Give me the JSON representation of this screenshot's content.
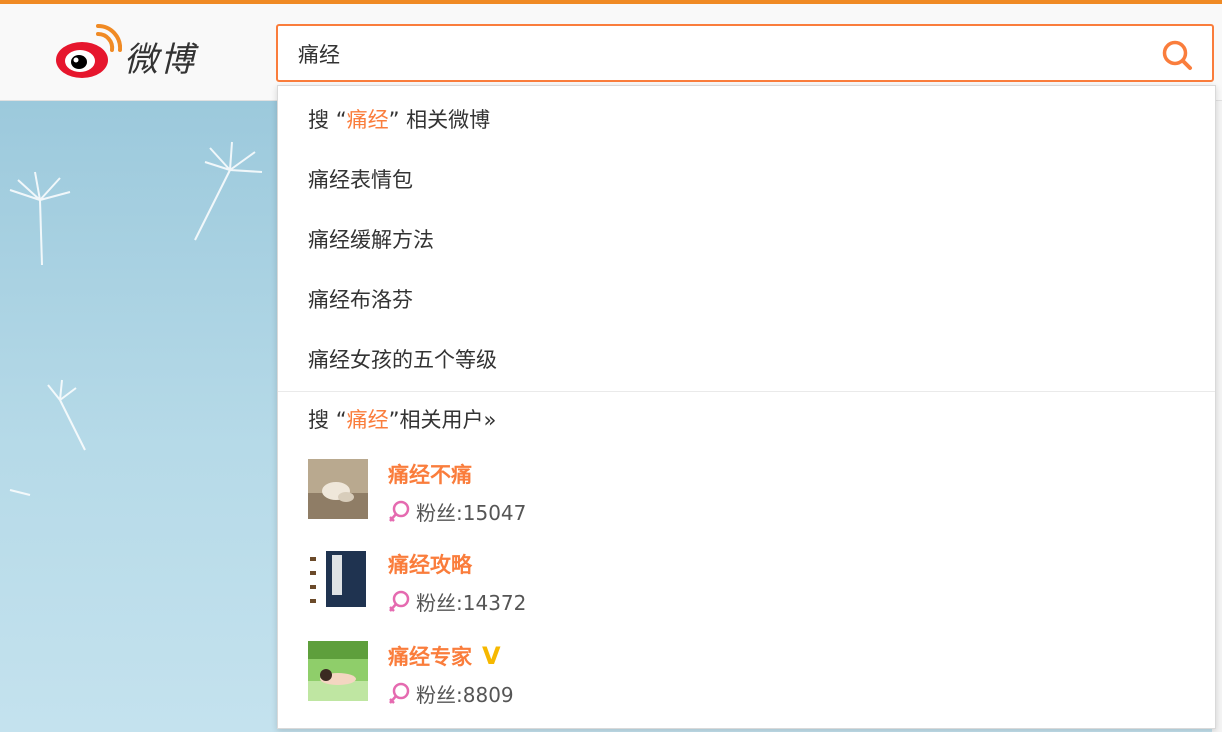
{
  "header": {
    "logo_text": "微博",
    "search": {
      "value": "痛经",
      "placeholder": ""
    }
  },
  "dropdown": {
    "weibo_search": {
      "prefix": "搜",
      "open_quote": "“",
      "keyword": "痛经",
      "close_quote": "”",
      "suffix": "相关微博"
    },
    "suggestions": [
      {
        "label": "痛经表情包"
      },
      {
        "label": "痛经缓解方法"
      },
      {
        "label": "痛经布洛芬"
      },
      {
        "label": "痛经女孩的五个等级"
      }
    ],
    "user_search": {
      "prefix": "搜",
      "open_quote": "“",
      "keyword": "痛经",
      "close_quote": "”",
      "suffix": "相关用户»"
    },
    "users": [
      {
        "name": "痛经不痛",
        "fans_label": "粉丝:",
        "fans": "15047",
        "verified": false
      },
      {
        "name": "痛经攻略",
        "fans_label": "粉丝:",
        "fans": "14372",
        "verified": false
      },
      {
        "name": "痛经专家",
        "fans_label": "粉丝:",
        "fans": "8809",
        "verified": true,
        "verified_mark": "V"
      }
    ]
  },
  "colors": {
    "accent": "#fa7d3c",
    "verified": "#f6b800",
    "fan_icon": "#e56ab0"
  },
  "icons": [
    "weibo-logo-icon",
    "search-icon",
    "fan-icon",
    "verified-icon"
  ]
}
